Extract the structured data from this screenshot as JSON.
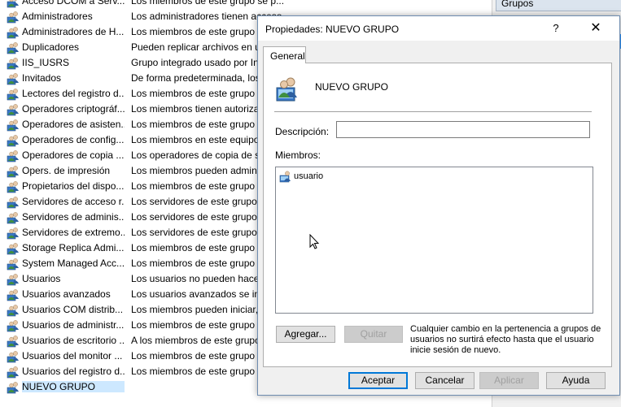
{
  "group_list": {
    "rows": [
      {
        "name": "Acceso DCOM a Serv...",
        "description": "Los miembros de este grupo se p...",
        "icon": "group-icon"
      },
      {
        "name": "Administradores",
        "description": "Los administradores tienen acceso",
        "icon": "group-icon"
      },
      {
        "name": "Administradores de H...",
        "description": "Los miembros de este grupo t",
        "icon": "group-icon"
      },
      {
        "name": "Duplicadores",
        "description": "Pueden replicar archivos en un",
        "icon": "group-icon"
      },
      {
        "name": "IIS_IUSRS",
        "description": "Grupo integrado usado por In",
        "icon": "group-icon"
      },
      {
        "name": "Invitados",
        "description": "De forma predeterminada, los",
        "icon": "group-icon"
      },
      {
        "name": "Lectores del registro d...",
        "description": "Los miembros de este grupo p",
        "icon": "group-icon"
      },
      {
        "name": "Operadores criptográf...",
        "description": "Los miembros tienen autoriza",
        "icon": "group-icon"
      },
      {
        "name": "Operadores de asisten...",
        "description": "Los miembros de este grupo p",
        "icon": "group-icon"
      },
      {
        "name": "Operadores de config...",
        "description": "Los miembros en este equipo",
        "icon": "group-icon"
      },
      {
        "name": "Operadores de copia ...",
        "description": "Los operadores de copia de se",
        "icon": "group-icon"
      },
      {
        "name": "Opers. de impresión",
        "description": "Los miembros pueden admin",
        "icon": "group-icon"
      },
      {
        "name": "Propietarios del dispo...",
        "description": "Los miembros de este grupo p",
        "icon": "group-icon"
      },
      {
        "name": "Servidores de acceso r...",
        "description": "Los servidores de este grupo p",
        "icon": "group-icon"
      },
      {
        "name": "Servidores de adminis...",
        "description": "Los servidores de este grupo p",
        "icon": "group-icon"
      },
      {
        "name": "Servidores de extremo...",
        "description": "Los servidores de este grupo e",
        "icon": "group-icon"
      },
      {
        "name": "Storage Replica Admi...",
        "description": "Los miembros de este grupo t",
        "icon": "group-icon"
      },
      {
        "name": "System Managed Acc...",
        "description": "Los miembros de este grupo l",
        "icon": "group-icon"
      },
      {
        "name": "Usuarios",
        "description": "Los usuarios no pueden hacer",
        "icon": "group-icon"
      },
      {
        "name": "Usuarios avanzados",
        "description": "Los usuarios avanzados se inc",
        "icon": "group-icon"
      },
      {
        "name": "Usuarios COM distrib...",
        "description": "Los miembros pueden iniciar,",
        "icon": "group-icon"
      },
      {
        "name": "Usuarios de administr...",
        "description": "Los miembros de este grupo p",
        "icon": "group-icon"
      },
      {
        "name": "Usuarios de escritorio ...",
        "description": "A los miembros de este grupo",
        "icon": "group-icon"
      },
      {
        "name": "Usuarios del monitor ...",
        "description": "Los miembros de este grupo p",
        "icon": "group-icon"
      },
      {
        "name": "Usuarios del registro d...",
        "description": "Los miembros de este grupo p",
        "icon": "group-icon"
      },
      {
        "name": "NUEVO GRUPO",
        "description": "",
        "icon": "group-icon"
      }
    ]
  },
  "actions_pane": {
    "header": "Grupos"
  },
  "dialog": {
    "title": "Propiedades: NUEVO GRUPO",
    "help_glyph": "?",
    "close_glyph": "✕",
    "tab_general": "General",
    "group_name": "NUEVO GRUPO",
    "description_label": "Descripción:",
    "description_value": "",
    "members_label": "Miembros:",
    "members": [
      {
        "name": "usuario",
        "icon": "user-icon"
      }
    ],
    "add_button": "Agregar...",
    "remove_button": "Quitar",
    "note": "Cualquier cambio en la pertenencia a grupos de usuarios no surtirá efecto hasta que el usuario inicie sesión de nuevo.",
    "ok_button": "Aceptar",
    "cancel_button": "Cancelar",
    "apply_button": "Aplicar",
    "help_button": "Ayuda"
  },
  "colors": {
    "selection": "#cde8ff",
    "accent": "#0078d7",
    "dialog_bg": "#f0f0f0"
  }
}
